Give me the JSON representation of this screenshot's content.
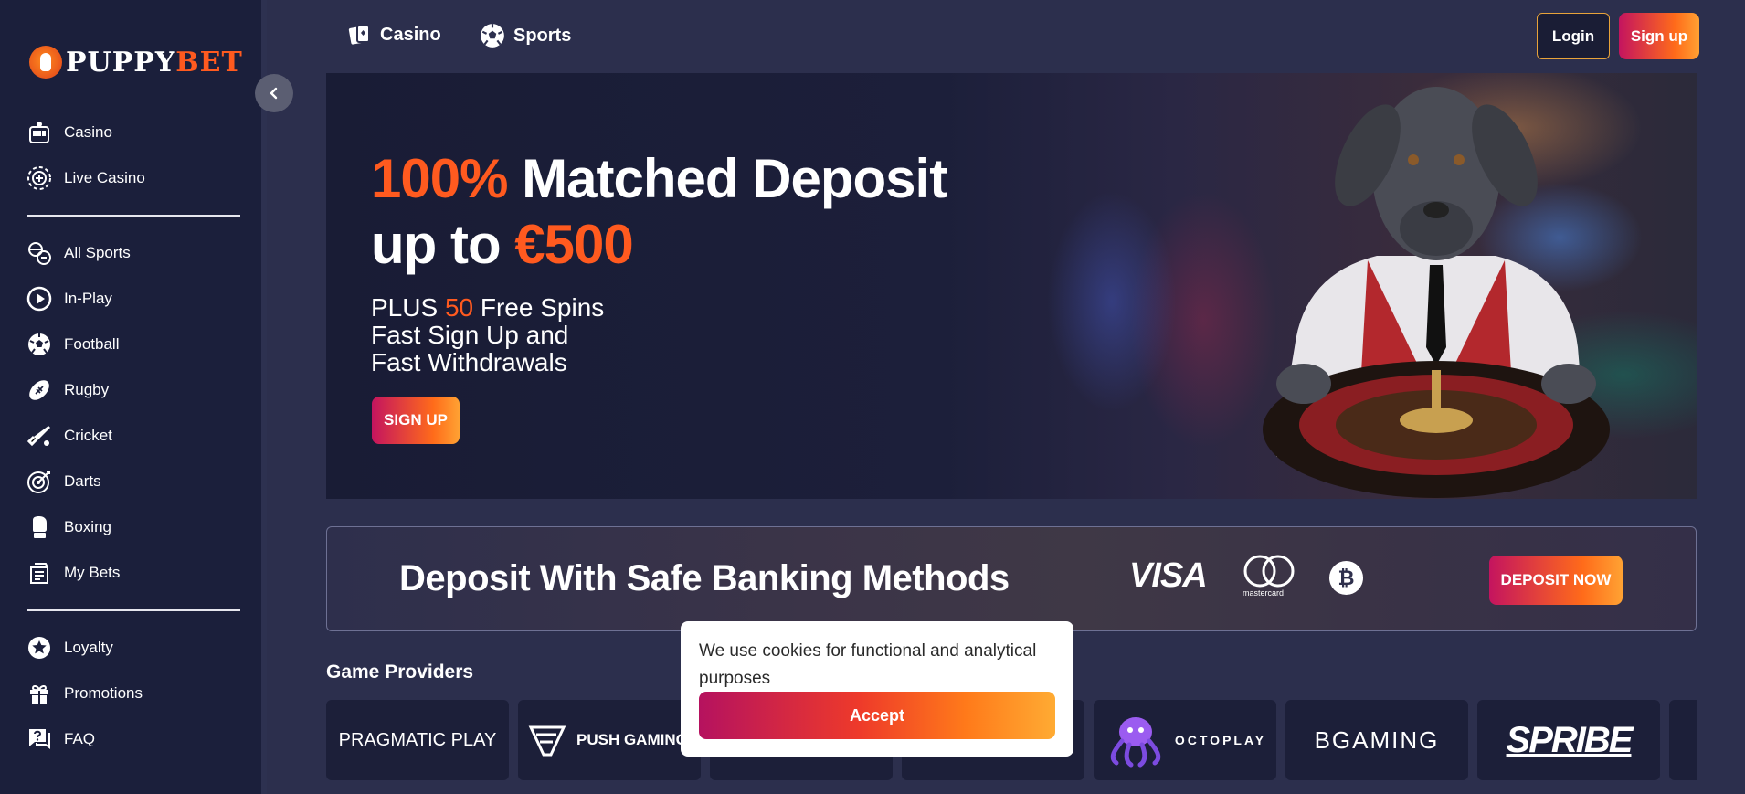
{
  "brand": {
    "part1": "PUPPY",
    "part2": "BET"
  },
  "sidebar": {
    "group1": [
      {
        "label": "Casino",
        "icon": "slot-machine-icon"
      },
      {
        "label": "Live Casino",
        "icon": "chip-icon"
      }
    ],
    "group2": [
      {
        "label": "All Sports",
        "icon": "sports-balls-icon"
      },
      {
        "label": "In-Play",
        "icon": "play-circle-icon"
      },
      {
        "label": "Football",
        "icon": "football-icon"
      },
      {
        "label": "Rugby",
        "icon": "rugby-ball-icon"
      },
      {
        "label": "Cricket",
        "icon": "cricket-bat-icon"
      },
      {
        "label": "Darts",
        "icon": "dartboard-icon"
      },
      {
        "label": "Boxing",
        "icon": "boxing-glove-icon"
      },
      {
        "label": "My Bets",
        "icon": "bet-slip-icon"
      }
    ],
    "group3": [
      {
        "label": "Loyalty",
        "icon": "star-icon"
      },
      {
        "label": "Promotions",
        "icon": "gift-icon"
      },
      {
        "label": "FAQ",
        "icon": "question-chat-icon"
      }
    ]
  },
  "topbar": {
    "tabs": [
      {
        "label": "Casino",
        "icon": "cards-icon"
      },
      {
        "label": "Sports",
        "icon": "soccer-ball-icon"
      }
    ],
    "login": "Login",
    "signup": "Sign up"
  },
  "hero": {
    "headline_pct": "100%",
    "headline_line1": " Matched Deposit",
    "headline_line2_prefix": "up to ",
    "headline_amount": "€500",
    "sub_plus": "PLUS ",
    "sub_spins_count": "50",
    "sub_spins": " Free Spins",
    "sub_line2": "Fast Sign Up and",
    "sub_line3": "Fast Withdrawals",
    "cta": "SIGN UP"
  },
  "deposit": {
    "title": "Deposit With Safe Banking Methods",
    "visa": "VISA",
    "mastercard": "mastercard",
    "bitcoin": "₿",
    "cta": "DEPOSIT NOW"
  },
  "providers": {
    "title": "Game Providers",
    "items": [
      {
        "name": "PRAGMATIC PLAY"
      },
      {
        "name": "PUSH GAMING"
      },
      {
        "name": ""
      },
      {
        "name": ""
      },
      {
        "name": "OCTOPLAY"
      },
      {
        "name": "BGAMING"
      },
      {
        "name": "SPRIBE"
      }
    ]
  },
  "cookie": {
    "text": "We use cookies for functional and analytical purposes",
    "accept": "Accept"
  },
  "colors": {
    "accent": "#ff5a1f",
    "sidebar": "#1b1f3b",
    "page": "#2c2f4d"
  }
}
